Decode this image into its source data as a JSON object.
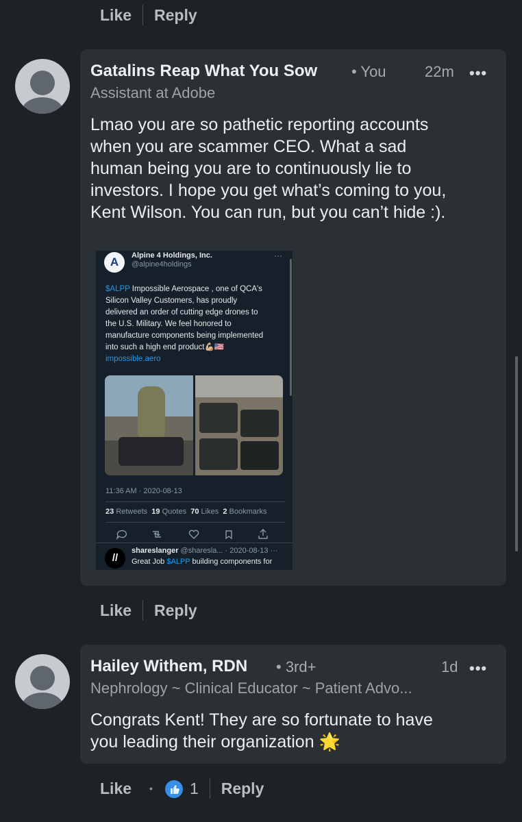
{
  "top_actions": {
    "like": "Like",
    "reply": "Reply"
  },
  "comment1": {
    "author": "Gatalins Reap What You Sow",
    "degree": "• You",
    "headline": "Assistant at Adobe",
    "time": "22m",
    "more": "•••",
    "text_lines": [
      "Lmao you are so pathetic reporting accounts",
      "when you are scammer CEO. What a sad",
      "human being you are to continuously lie to",
      "investors. I hope you get what’s coming to you,",
      "Kent Wilson. You can run, but you can’t hide :)."
    ],
    "actions": {
      "like": "Like",
      "reply": "Reply"
    }
  },
  "tweet": {
    "account_name": "Alpine 4 Holdings, Inc.",
    "handle": "@alpine4holdings",
    "logo": "A",
    "more": "···",
    "cashtag": "$ALPP",
    "body_first": " Impossible Aerospace , one of QCA's",
    "body_lines": [
      "Silicon Valley Customers, has proudly",
      "delivered an order of cutting edge drones to",
      "the U.S. Military. We feel honored to",
      "manufacture components being implemented",
      "into such a high end product💪🏼🇺🇸"
    ],
    "link": "impossible.aero",
    "timestamp": "11:36 AM · 2020-08-13",
    "stats": {
      "retweets_count": "23",
      "retweets_label": "Retweets",
      "quotes_count": "19",
      "quotes_label": "Quotes",
      "likes_count": "70",
      "likes_label": "Likes",
      "bookmarks_count": "2",
      "bookmarks_label": "Bookmarks"
    },
    "reply": {
      "name": "shareslanger",
      "handle": "@sharesla... · 2020-08-13",
      "more": "···",
      "text_prefix": "Great Job ",
      "text_cashtag": "$ALPP",
      "text_suffix": " building components for"
    }
  },
  "comment2": {
    "author": "Hailey Withem, RDN",
    "degree": "• 3rd+",
    "headline": "Nephrology ~ Clinical Educator ~ Patient Advo...",
    "time": "1d",
    "more": "•••",
    "text_lines": [
      "Congrats Kent! They are so fortunate to have",
      "you leading their organization 🌟"
    ],
    "actions": {
      "like": "Like",
      "dot": "•",
      "reaction_count": "1",
      "reply": "Reply"
    }
  },
  "colors": {
    "background": "#1d2226",
    "bubble": "#2b3035",
    "link_blue": "#1d9bf0",
    "reaction_blue": "#378fe9"
  }
}
